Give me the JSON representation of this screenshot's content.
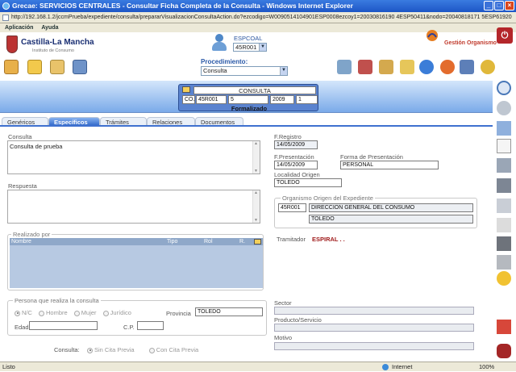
{
  "window": {
    "title": "Grecae: SERVICIOS CENTRALES - Consultar Ficha Completa de la Consulta - Windows Internet Explorer"
  },
  "address": {
    "url": "http://192.168.1.2/jccmPrueba/expediente/consulta/prepararVisualizacionConsultaAction.do?ezcodigo=W0090514104901ESP0008ezcoy1=20030816190 4ESP50411&nodo=20040818171 5ESP61920"
  },
  "menu": {
    "items": [
      "Aplicación",
      "Ayuda"
    ]
  },
  "brand": {
    "name": "Castilla-La Mancha",
    "subtitle": "Instituto de Consumo"
  },
  "user": {
    "group_label": "ESPCOAL",
    "group_value": "45R001"
  },
  "gestion": {
    "label": "Gestión Organismo"
  },
  "procedimiento": {
    "label": "Procedimiento:",
    "value": "Consulta"
  },
  "toolbar": {
    "icons": [
      "folder-key-icon",
      "folder-open-icon",
      "folder-icon",
      "computer-folder-icon"
    ]
  },
  "toolbar_right": {
    "icons": [
      "laptop-icon",
      "books-icon",
      "archive-icon",
      "stamp-icon",
      "globe-icon",
      "world-map-icon",
      "user-plus-icon",
      "gears-icon"
    ]
  },
  "consulta_box": {
    "title": "CONSULTA",
    "cells": [
      "CO.",
      "45R001",
      "5",
      "2009",
      "1"
    ],
    "status": "Formalizado"
  },
  "tabs": [
    "Genéricos",
    "Específicos",
    "Trámites",
    "Relaciones",
    "Documentos"
  ],
  "form": {
    "consulta_label": "Consulta",
    "consulta_value": "Consulta de prueba",
    "respuesta_label": "Respuesta",
    "respuesta_value": "",
    "realizado_label": "Realizado por",
    "realizado_cols": [
      "Nombre",
      "Tipo",
      "Rol",
      "R."
    ],
    "freg_label": "F.Registro",
    "freg_value": "14/05/2009",
    "fpres_label": "F.Presentación",
    "fpres_value": "14/05/2009",
    "forma_label": "Forma de Presentación",
    "forma_value": "PERSONAL",
    "localidad_label": "Localidad Origen",
    "localidad_value": "TOLEDO",
    "organismo_legend": "Organismo Origen del Expediente",
    "org_code": "45R001",
    "org_name": "DIRECCION GENERAL DEL CONSUMO",
    "org_city": "TOLEDO",
    "tramitador_label": "Tramitador",
    "tramitador_value": "ESPIRAL . .",
    "persona_legend": "Persona que realiza la consulta",
    "radios": [
      "N/C",
      "Hombre",
      "Mujer",
      "Jurídico"
    ],
    "provincia_label": "Provincia",
    "provincia_value": "TOLEDO",
    "edad_label": "Edad",
    "cp_label": "C.P.",
    "sector_label": "Sector",
    "producto_label": "Producto/Servicio",
    "motivo_label": "Motivo",
    "consulta2_label": "Consulta:",
    "sin_cita": "Sin Cita Previa",
    "con_cita": "Con Cita Previa"
  },
  "side_icons": [
    "magnifier-icon",
    "back-icon",
    "stack-icon",
    "document-icon",
    "pages-icon",
    "binders-icon",
    "scales-icon",
    "attach-icon",
    "trash-icon",
    "printer-icon",
    "sun-icon",
    "tools-icon",
    "car-icon"
  ],
  "status": {
    "left": "Listo",
    "zone": "Internet",
    "zoom": "100%"
  }
}
